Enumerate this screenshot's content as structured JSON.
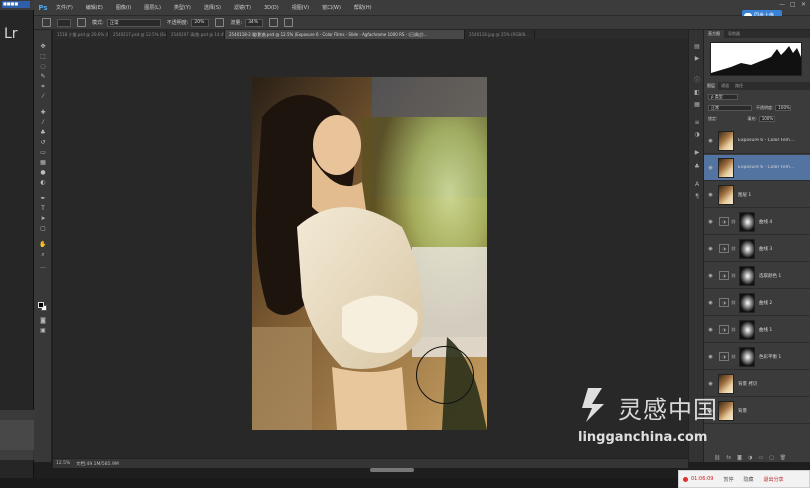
{
  "left_app": {
    "label": "Lr",
    "title_tag": "■■■■"
  },
  "app": {
    "logo": "Ps"
  },
  "menu": [
    "文件(F)",
    "编辑(E)",
    "图像(I)",
    "图层(L)",
    "类型(Y)",
    "选择(S)",
    "滤镜(T)",
    "3D(D)",
    "视图(V)",
    "窗口(W)",
    "帮助(H)"
  ],
  "cloud_button": "同步上传",
  "window_controls": [
    "—",
    "□",
    "✕"
  ],
  "options": {
    "mode_label": "模式:",
    "mode_value": "正常",
    "opacity_label": "不透明度:",
    "opacity_value": "20%",
    "flow_label": "流量:",
    "flow_value": "34%"
  },
  "tabs": [
    {
      "label": "1518 小雏.psd @ 20.6% (Exposure...",
      "active": false
    },
    {
      "label": "2540217.psd @ 12.5% (Exposure...",
      "active": false
    },
    {
      "label": "2540207 清/曲.psd @ 14.4% (RGB/...",
      "active": false
    },
    {
      "label": "2540118-2 暖(影曲.psd @ 12.5% (Exposure 6 - Color Films - Slide - Agfachrome 1000 RS - (已调过)...",
      "active": true
    },
    {
      "label": "2540118.jpg @ 25% (RGB/8...",
      "active": false
    }
  ],
  "status": {
    "zoom": "12.5%",
    "doc": "文档:49.1M/585.9M"
  },
  "panel": {
    "top_tabs": [
      "直方图",
      "导航器"
    ],
    "layer_tabs": [
      "图层",
      "通道",
      "路径"
    ],
    "kind_label": "ρ 类型",
    "blend_mode": "正常",
    "opacity_label": "不透明度:",
    "opacity_value": "100%",
    "lock_label": "锁定:",
    "fill_label": "填充:",
    "fill_value": "100%"
  },
  "layers": [
    {
      "name": "Exposure 6 - Color Film...",
      "type": "photo",
      "selected": false
    },
    {
      "name": "Exposure 6 - Color Film...",
      "type": "photo",
      "selected": true
    },
    {
      "name": "图层 1",
      "type": "photo",
      "selected": false
    },
    {
      "name": "曲线 4",
      "type": "curve",
      "selected": false
    },
    {
      "name": "曲线 3",
      "type": "curve",
      "selected": false
    },
    {
      "name": "选取颜色 1",
      "type": "curve",
      "selected": false
    },
    {
      "name": "曲线 2",
      "type": "curve",
      "selected": false
    },
    {
      "name": "曲线 1",
      "type": "curve",
      "selected": false
    },
    {
      "name": "色彩平衡 1",
      "type": "curve",
      "selected": false
    },
    {
      "name": "背景 拷贝",
      "type": "photo",
      "selected": false
    },
    {
      "name": "背景",
      "type": "photo",
      "selected": false
    }
  ],
  "recording": {
    "time": "01:06:09",
    "pause": "暂停",
    "minimize": "隐藏",
    "stop": "退出分享"
  },
  "watermark": {
    "text": "灵感中国",
    "url": "lingganchina.com"
  }
}
